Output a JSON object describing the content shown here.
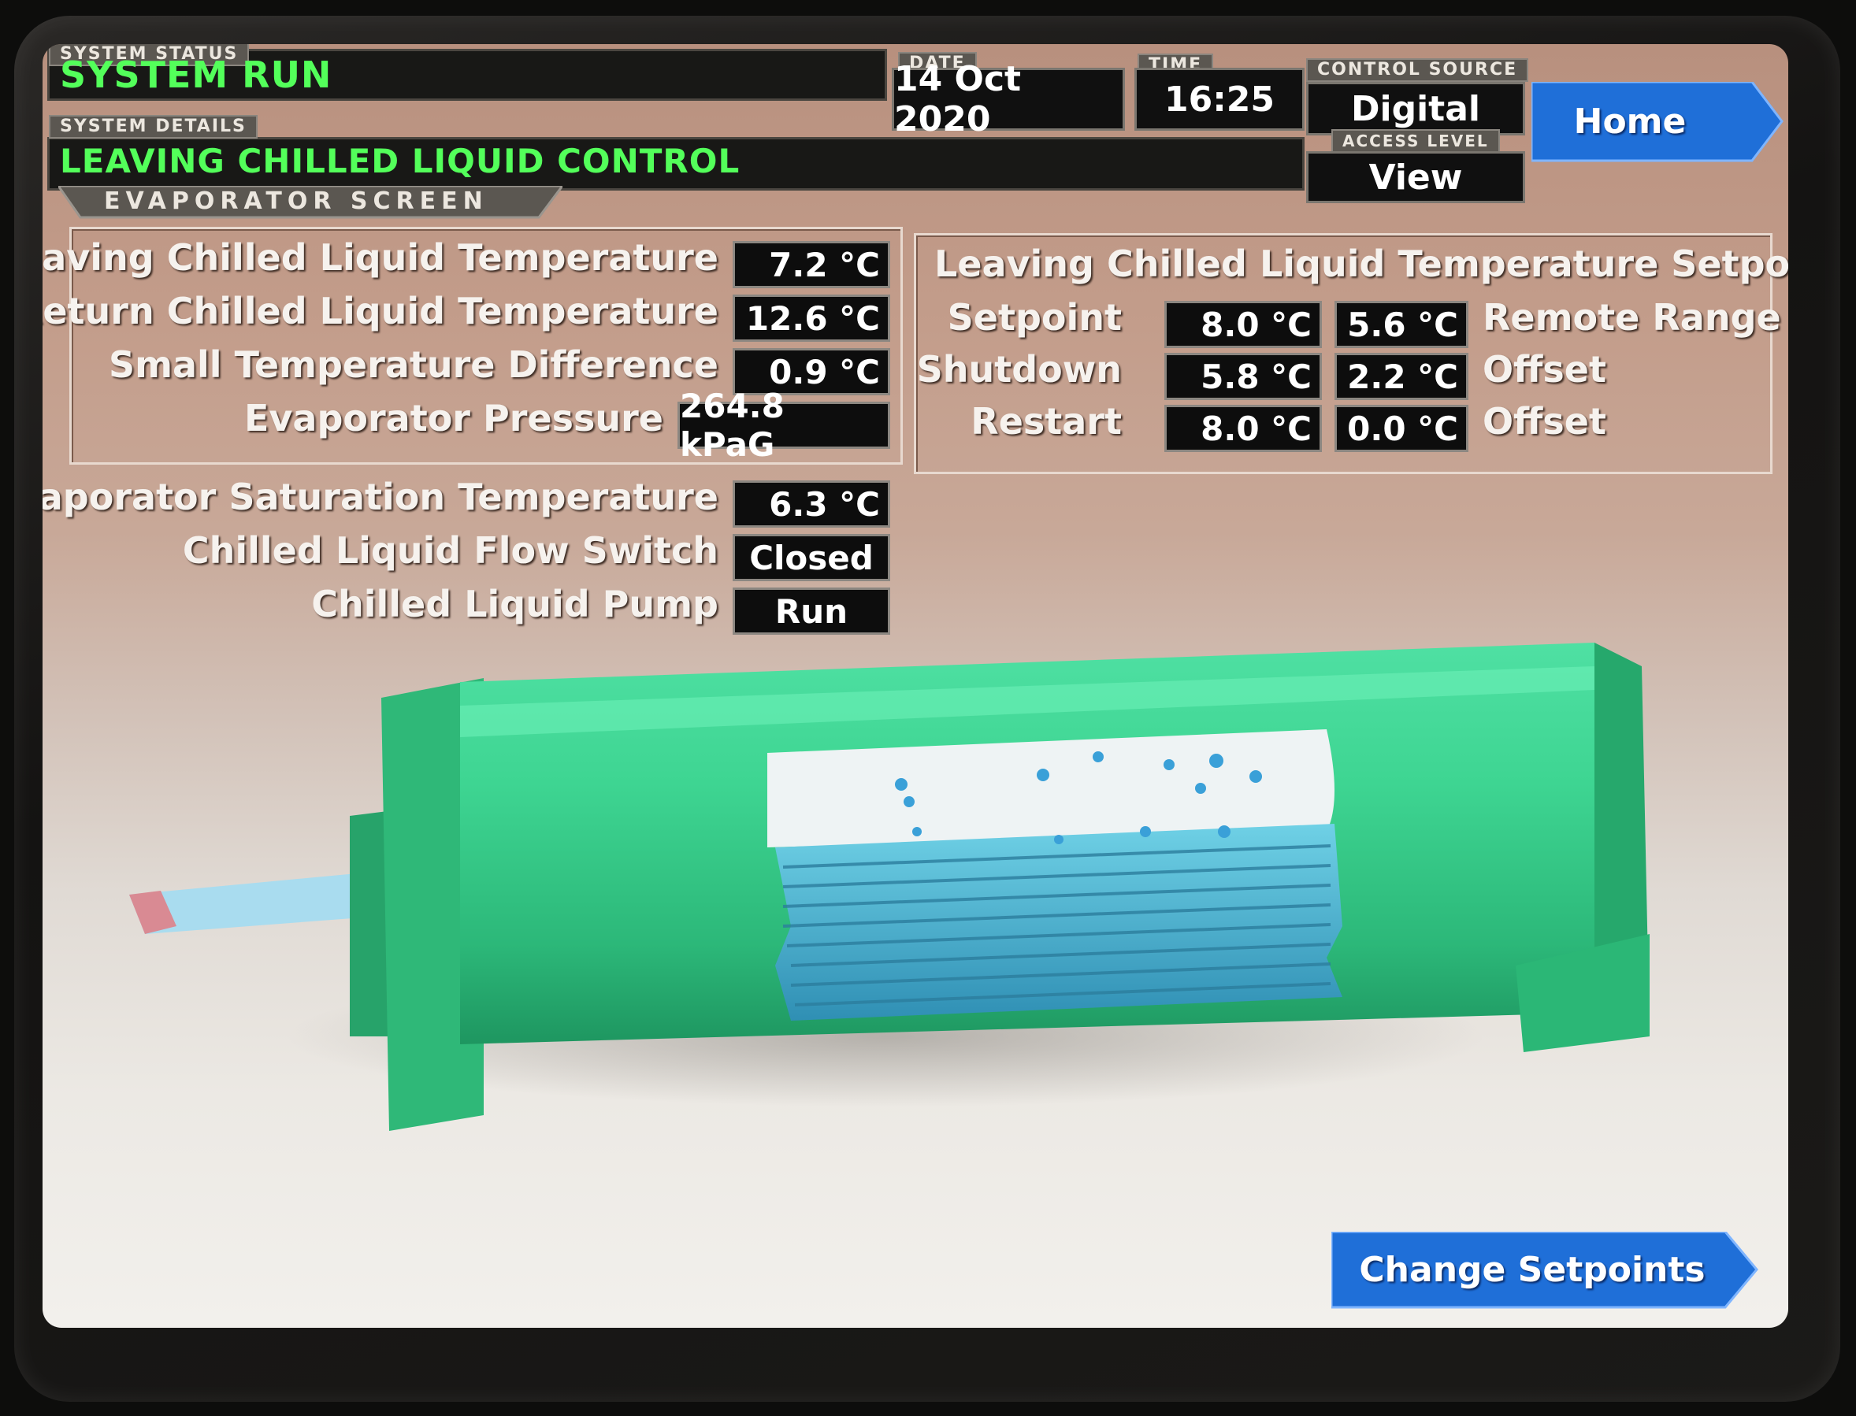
{
  "header": {
    "system_status_label": "SYSTEM STATUS",
    "system_status": "SYSTEM RUN",
    "system_details_label": "SYSTEM DETAILS",
    "system_details": "LEAVING CHILLED LIQUID CONTROL",
    "screen_name": "EVAPORATOR SCREEN",
    "date_label": "DATE",
    "date": "14 Oct 2020",
    "time_label": "TIME",
    "time": "16:25",
    "control_source_label": "CONTROL SOURCE",
    "control_source": "Digital",
    "access_level_label": "ACCESS LEVEL",
    "access_level": "View",
    "home_button": "Home"
  },
  "evaporator": {
    "leaving_temp_label": "Leaving Chilled Liquid Temperature",
    "leaving_temp": "7.2 °C",
    "return_temp_label": "Return Chilled Liquid Temperature",
    "return_temp": "12.6 °C",
    "small_diff_label": "Small Temperature Difference",
    "small_diff": "0.9 °C",
    "pressure_label": "Evaporator Pressure",
    "pressure": "264.8 kPaG",
    "sat_temp_label": "Evaporator Saturation Temperature",
    "sat_temp": "6.3 °C",
    "flow_switch_label": "Chilled Liquid Flow Switch",
    "flow_switch": "Closed",
    "pump_label": "Chilled Liquid Pump",
    "pump": "Run"
  },
  "setpoints": {
    "title": "Leaving Chilled Liquid Temperature Setpoints",
    "setpoint_label": "Setpoint",
    "setpoint": "8.0 °C",
    "remote_range": "5.6 °C",
    "remote_range_label": "Remote Range",
    "shutdown_label": "Shutdown",
    "shutdown": "5.8 °C",
    "shutdown_offset": "2.2 °C",
    "shutdown_offset_label": "Offset",
    "restart_label": "Restart",
    "restart": "8.0 °C",
    "restart_offset": "0.0 °C",
    "restart_offset_label": "Offset"
  },
  "actions": {
    "change_setpoints": "Change Setpoints"
  },
  "colors": {
    "status_green": "#53ff5a",
    "button_blue": "#1f6fd8",
    "evaporator_green": "#33c98a"
  },
  "icons": {
    "evaporator_illustration": "evaporator-cutaway-illustration"
  }
}
